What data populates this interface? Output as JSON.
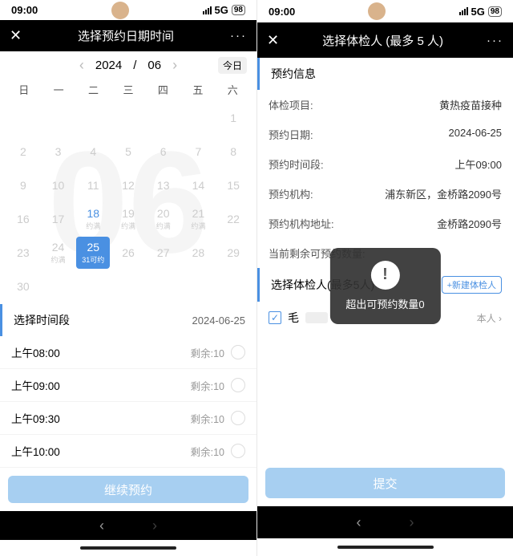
{
  "status": {
    "time": "09:00",
    "net": "5G",
    "battery": "98"
  },
  "left": {
    "title": "选择预约日期时间",
    "calendar": {
      "year": "2024",
      "month": "06",
      "today_btn": "今日",
      "big": "06",
      "dow": [
        "日",
        "一",
        "二",
        "三",
        "四",
        "五",
        "六"
      ],
      "cells": [
        {
          "d": "",
          "s": ""
        },
        {
          "d": "",
          "s": ""
        },
        {
          "d": "",
          "s": ""
        },
        {
          "d": "",
          "s": ""
        },
        {
          "d": "",
          "s": ""
        },
        {
          "d": "",
          "s": ""
        },
        {
          "d": "1",
          "s": "",
          "cls": ""
        },
        {
          "d": "2",
          "s": ""
        },
        {
          "d": "3",
          "s": ""
        },
        {
          "d": "4",
          "s": ""
        },
        {
          "d": "5",
          "s": ""
        },
        {
          "d": "6",
          "s": ""
        },
        {
          "d": "7",
          "s": ""
        },
        {
          "d": "8",
          "s": ""
        },
        {
          "d": "9",
          "s": ""
        },
        {
          "d": "10",
          "s": ""
        },
        {
          "d": "11",
          "s": ""
        },
        {
          "d": "12",
          "s": ""
        },
        {
          "d": "13",
          "s": ""
        },
        {
          "d": "14",
          "s": ""
        },
        {
          "d": "15",
          "s": ""
        },
        {
          "d": "16",
          "s": ""
        },
        {
          "d": "17",
          "s": ""
        },
        {
          "d": "18",
          "s": "约满",
          "cls": "blue"
        },
        {
          "d": "19",
          "s": "约满"
        },
        {
          "d": "20",
          "s": "约满"
        },
        {
          "d": "21",
          "s": "约满"
        },
        {
          "d": "22",
          "s": ""
        },
        {
          "d": "23",
          "s": ""
        },
        {
          "d": "24",
          "s": "约满"
        },
        {
          "d": "25",
          "s": "31可约",
          "cls": "sel"
        },
        {
          "d": "26",
          "s": ""
        },
        {
          "d": "27",
          "s": ""
        },
        {
          "d": "28",
          "s": ""
        },
        {
          "d": "29",
          "s": ""
        },
        {
          "d": "30",
          "s": ""
        }
      ]
    },
    "timesec": {
      "label": "选择时间段",
      "date": "2024-06-25"
    },
    "slots": [
      {
        "t": "上午08:00",
        "r": "剩余:10"
      },
      {
        "t": "上午09:00",
        "r": "剩余:10"
      },
      {
        "t": "上午09:30",
        "r": "剩余:10"
      },
      {
        "t": "上午10:00",
        "r": "剩余:10"
      }
    ],
    "btn": "继续预约"
  },
  "right": {
    "title": "选择体检人 (最多 5 人)",
    "sec1": "预约信息",
    "info": [
      {
        "k": "体检项目:",
        "v": "黄热疫苗接种"
      },
      {
        "k": "预约日期:",
        "v": "2024-06-25"
      },
      {
        "k": "预约时间段:",
        "v": "上午09:00"
      },
      {
        "k": "预约机构:",
        "v": "浦东新区，金桥路2090号"
      },
      {
        "k": "预约机构地址:",
        "v": "金桥路2090号"
      },
      {
        "k": "当前剩余可预约数量:",
        "v": ""
      }
    ],
    "sec2": "选择体检人(最多5人)",
    "addbtn": "+新建体检人",
    "person": {
      "name": "毛",
      "self": "本人 ›"
    },
    "toast": "超出可预约数量0",
    "btn": "提交"
  }
}
